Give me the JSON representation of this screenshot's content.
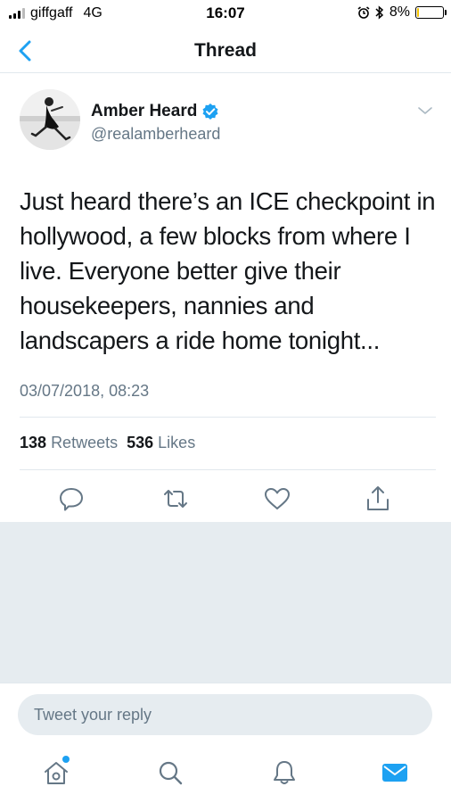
{
  "status_bar": {
    "carrier": "giffgaff",
    "network": "4G",
    "time": "16:07",
    "battery_percent": "8%",
    "battery_level": 0.08,
    "icons": [
      "signal-icon",
      "alarm-icon",
      "bluetooth-icon",
      "battery-icon"
    ]
  },
  "nav": {
    "title": "Thread",
    "back_icon": "chevron-left-icon"
  },
  "tweet": {
    "author_name": "Amber Heard",
    "verified": true,
    "handle": "@realamberheard",
    "text": "Just heard there’s an ICE checkpoint in hollywood, a few blocks from where I live.  Everyone better give their housekeepers, nannies and landscapers a ride home tonight...",
    "timestamp": "03/07/2018, 08:23",
    "retweets_count": "138",
    "retweets_label": "Retweets",
    "likes_count": "536",
    "likes_label": "Likes"
  },
  "reply": {
    "placeholder": "Tweet your reply"
  },
  "colors": {
    "accent": "#1da1f2",
    "text": "#14171a",
    "secondary": "#657786",
    "gray_background": "#e6ecf0"
  }
}
